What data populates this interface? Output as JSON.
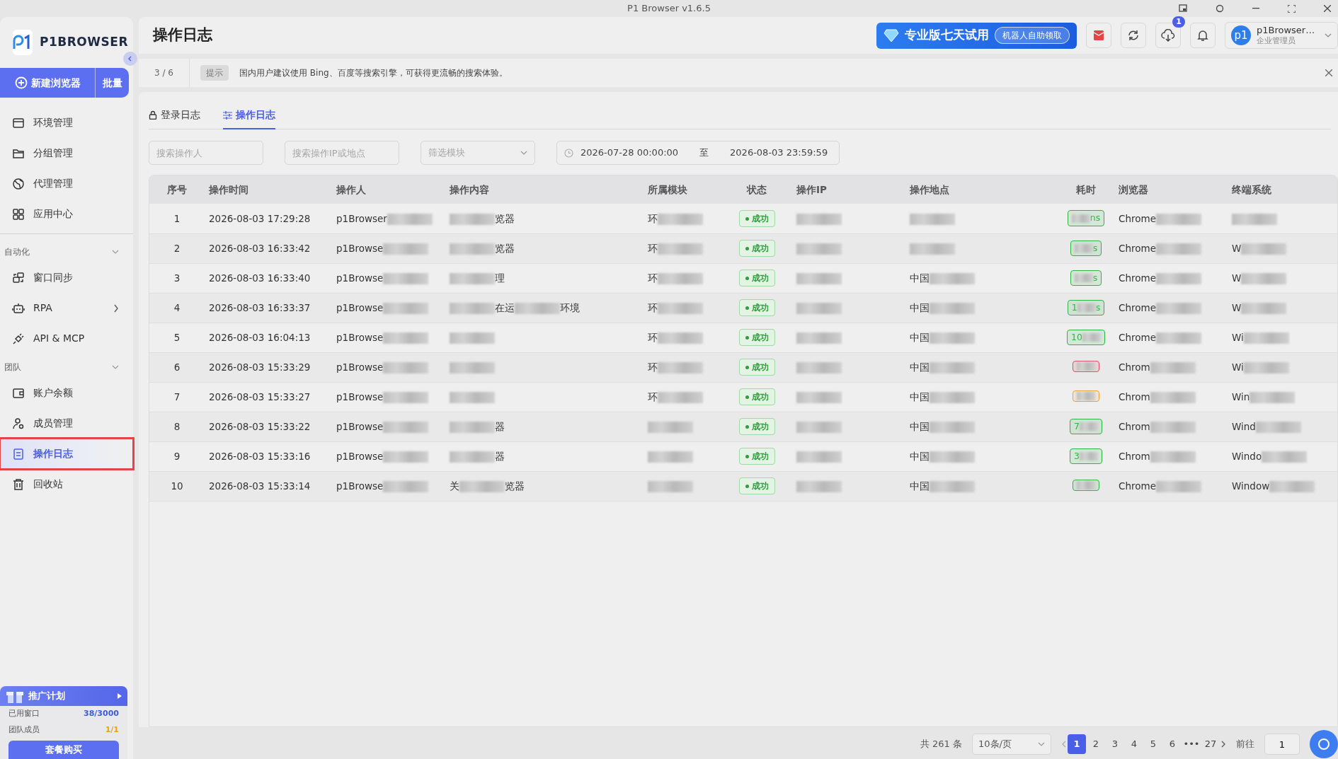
{
  "window": {
    "title": "P1 Browser v1.6.5"
  },
  "sidebar": {
    "logo": "P1BROWSER",
    "new_button": "新建浏览器",
    "batch_button": "批量",
    "groups": [
      {
        "items": [
          {
            "label": "环境管理",
            "selected": false
          },
          {
            "label": "分组管理",
            "selected": false
          },
          {
            "label": "代理管理",
            "selected": false
          },
          {
            "label": "应用中心",
            "selected": false
          }
        ]
      },
      {
        "title": "自动化",
        "expanded": true,
        "items": [
          {
            "label": "窗口同步",
            "selected": false
          },
          {
            "label": "RPA",
            "selected": false,
            "submenu": true
          },
          {
            "label": "API & MCP",
            "selected": false
          }
        ]
      },
      {
        "title": "团队",
        "expanded": true,
        "items": [
          {
            "label": "账户余额",
            "selected": false
          },
          {
            "label": "成员管理",
            "selected": false
          },
          {
            "label": "操作日志",
            "selected": true
          },
          {
            "label": "回收站",
            "selected": false
          }
        ]
      }
    ],
    "promo": {
      "title": "推广计划",
      "stats": [
        {
          "label": "已用窗口",
          "value": "38/3000",
          "color": "#3b5bdb"
        },
        {
          "label": "团队成员",
          "value": "1/1",
          "color": "#e8a317"
        }
      ],
      "button": "套餐购买"
    }
  },
  "header": {
    "title": "操作日志",
    "trial": "专业版七天试用",
    "trial_button": "机器人自助领取",
    "download_badge": "1",
    "user": {
      "avatar": "p1",
      "name": "p1Browser…",
      "role": "企业管理员"
    }
  },
  "notice": {
    "counter": "3 / 6",
    "tag": "提示",
    "text": "国内用户建议使用 Bing、百度等搜索引擎，可获得更流畅的搜索体验。"
  },
  "tabs": [
    {
      "label": "登录日志",
      "selected": false
    },
    {
      "label": "操作日志",
      "selected": true
    }
  ],
  "filters": {
    "operator": {
      "placeholder": "搜索操作人"
    },
    "ip": {
      "placeholder": "搜索操作IP或地点"
    },
    "module": {
      "placeholder": "筛选模块"
    },
    "date_from": "2026-07-28 00:00:00",
    "date_sep": "至",
    "date_to": "2026-08-03 23:59:59"
  },
  "table": {
    "columns": [
      "序号",
      "操作时间",
      "操作人",
      "操作内容",
      "所属模块",
      "状态",
      "操作IP",
      "操作地点",
      "耗时",
      "浏览器",
      "终端系统"
    ],
    "rows": [
      {
        "no": "1",
        "time": "2026-08-03 17:29:28",
        "operator": [
          {
            "text": "p1Browser"
          },
          {
            "redacted": true
          }
        ],
        "content": [
          {
            "redacted": true
          },
          {
            "text": "览器"
          }
        ],
        "module": [
          {
            "text": "环"
          },
          {
            "redacted": true
          }
        ],
        "status": "成功",
        "ip": [
          {
            "redacted": true
          }
        ],
        "location": [
          {
            "redacted": true
          }
        ],
        "duration": {
          "parts": [
            {
              "redacted": true
            },
            {
              "text": "ns"
            }
          ],
          "color": "#2fb344"
        },
        "browser": [
          {
            "text": "Chrome"
          },
          {
            "redacted": true
          }
        ],
        "os": [
          {
            "redacted": true
          }
        ]
      },
      {
        "no": "2",
        "time": "2026-08-03 16:33:42",
        "operator": [
          {
            "text": "p1Browse"
          },
          {
            "redacted": true
          }
        ],
        "content": [
          {
            "redacted": true
          },
          {
            "text": "览器"
          }
        ],
        "module": [
          {
            "text": "环"
          },
          {
            "redacted": true
          }
        ],
        "status": "成功",
        "ip": [
          {
            "redacted": true
          }
        ],
        "location": [
          {
            "redacted": true
          }
        ],
        "duration": {
          "parts": [
            {
              "redacted": true
            },
            {
              "text": "s"
            }
          ],
          "color": "#2fb344"
        },
        "browser": [
          {
            "text": "Chrome"
          },
          {
            "redacted": true
          }
        ],
        "os": [
          {
            "text": "W"
          },
          {
            "redacted": true
          }
        ]
      },
      {
        "no": "3",
        "time": "2026-08-03 16:33:40",
        "operator": [
          {
            "text": "p1Browse"
          },
          {
            "redacted": true
          }
        ],
        "content": [
          {
            "redacted": true
          },
          {
            "text": "理"
          }
        ],
        "module": [
          {
            "text": "环"
          },
          {
            "redacted": true
          }
        ],
        "status": "成功",
        "ip": [
          {
            "redacted": true
          }
        ],
        "location": [
          {
            "text": "中国"
          },
          {
            "redacted": true
          }
        ],
        "duration": {
          "parts": [
            {
              "redacted": true
            },
            {
              "text": "s"
            }
          ],
          "color": "#2fb344"
        },
        "browser": [
          {
            "text": "Chrome"
          },
          {
            "redacted": true
          }
        ],
        "os": [
          {
            "text": "W"
          },
          {
            "redacted": true
          }
        ]
      },
      {
        "no": "4",
        "time": "2026-08-03 16:33:37",
        "operator": [
          {
            "text": "p1Browse"
          },
          {
            "redacted": true
          }
        ],
        "content": [
          {
            "redacted": true
          },
          {
            "text": "在运"
          },
          {
            "redacted": true
          },
          {
            "text": "环境"
          }
        ],
        "module": [
          {
            "text": "环"
          },
          {
            "redacted": true
          }
        ],
        "status": "成功",
        "ip": [
          {
            "redacted": true
          }
        ],
        "location": [
          {
            "text": "中国"
          },
          {
            "redacted": true
          }
        ],
        "duration": {
          "parts": [
            {
              "text": "1"
            },
            {
              "redacted": true
            },
            {
              "text": "s"
            }
          ],
          "color": "#2fb344"
        },
        "browser": [
          {
            "text": "Chrome"
          },
          {
            "redacted": true
          }
        ],
        "os": [
          {
            "text": "W"
          },
          {
            "redacted": true
          }
        ]
      },
      {
        "no": "5",
        "time": "2026-08-03 16:04:13",
        "operator": [
          {
            "text": "p1Browse"
          },
          {
            "redacted": true
          }
        ],
        "content": [
          {
            "redacted": true
          }
        ],
        "module": [
          {
            "text": "环"
          },
          {
            "redacted": true
          }
        ],
        "status": "成功",
        "ip": [
          {
            "redacted": true
          }
        ],
        "location": [
          {
            "text": "中国"
          },
          {
            "redacted": true
          }
        ],
        "duration": {
          "parts": [
            {
              "text": "10"
            },
            {
              "redacted": true
            }
          ],
          "color": "#2fb344"
        },
        "browser": [
          {
            "text": "Chrome"
          },
          {
            "redacted": true
          }
        ],
        "os": [
          {
            "text": "Wi"
          },
          {
            "redacted": true
          }
        ]
      },
      {
        "no": "6",
        "time": "2026-08-03 15:33:29",
        "operator": [
          {
            "text": "p1Browse"
          },
          {
            "redacted": true
          }
        ],
        "content": [
          {
            "redacted": true
          }
        ],
        "module": [
          {
            "text": "环"
          },
          {
            "redacted": true
          }
        ],
        "status": "成功",
        "ip": [
          {
            "redacted": true
          }
        ],
        "location": [
          {
            "text": "中国"
          },
          {
            "redacted": true
          }
        ],
        "duration": {
          "parts": [
            {
              "redacted": true
            }
          ],
          "color": "#e5485f"
        },
        "browser": [
          {
            "text": "Chrom"
          },
          {
            "redacted": true
          }
        ],
        "os": [
          {
            "text": "Wi"
          },
          {
            "redacted": true
          }
        ]
      },
      {
        "no": "7",
        "time": "2026-08-03 15:33:27",
        "operator": [
          {
            "text": "p1Browse"
          },
          {
            "redacted": true
          }
        ],
        "content": [
          {
            "redacted": true
          }
        ],
        "module": [
          {
            "text": "环"
          },
          {
            "redacted": true
          }
        ],
        "status": "成功",
        "ip": [
          {
            "redacted": true
          }
        ],
        "location": [
          {
            "text": "中国"
          },
          {
            "redacted": true
          }
        ],
        "duration": {
          "parts": [
            {
              "redacted": true
            }
          ],
          "color": "#f0a030"
        },
        "browser": [
          {
            "text": "Chrom"
          },
          {
            "redacted": true
          }
        ],
        "os": [
          {
            "text": "Win"
          },
          {
            "redacted": true
          }
        ]
      },
      {
        "no": "8",
        "time": "2026-08-03 15:33:22",
        "operator": [
          {
            "text": "p1Browse"
          },
          {
            "redacted": true
          }
        ],
        "content": [
          {
            "redacted": true
          },
          {
            "text": "器"
          }
        ],
        "module": [
          {
            "redacted": true
          }
        ],
        "status": "成功",
        "ip": [
          {
            "redacted": true
          }
        ],
        "location": [
          {
            "text": "中国"
          },
          {
            "redacted": true
          }
        ],
        "duration": {
          "parts": [
            {
              "text": "7"
            },
            {
              "redacted": true
            }
          ],
          "color": "#2fb344"
        },
        "browser": [
          {
            "text": "Chrom"
          },
          {
            "redacted": true
          }
        ],
        "os": [
          {
            "text": "Wind"
          },
          {
            "redacted": true
          }
        ]
      },
      {
        "no": "9",
        "time": "2026-08-03 15:33:16",
        "operator": [
          {
            "text": "p1Browse"
          },
          {
            "redacted": true
          }
        ],
        "content": [
          {
            "redacted": true
          },
          {
            "text": "器"
          }
        ],
        "module": [
          {
            "redacted": true
          }
        ],
        "status": "成功",
        "ip": [
          {
            "redacted": true
          }
        ],
        "location": [
          {
            "text": "中国"
          },
          {
            "redacted": true
          }
        ],
        "duration": {
          "parts": [
            {
              "text": "3"
            },
            {
              "redacted": true
            }
          ],
          "color": "#2fb344"
        },
        "browser": [
          {
            "text": "Chrom"
          },
          {
            "redacted": true
          }
        ],
        "os": [
          {
            "text": "Windo"
          },
          {
            "redacted": true
          }
        ]
      },
      {
        "no": "10",
        "time": "2026-08-03 15:33:14",
        "operator": [
          {
            "text": "p1Browse"
          },
          {
            "redacted": true
          }
        ],
        "content": [
          {
            "text": "关"
          },
          {
            "redacted": true
          },
          {
            "text": "览器"
          }
        ],
        "module": [
          {
            "redacted": true
          }
        ],
        "status": "成功",
        "ip": [
          {
            "redacted": true
          }
        ],
        "location": [
          {
            "text": "中国"
          },
          {
            "redacted": true
          }
        ],
        "duration": {
          "parts": [
            {
              "redacted": true
            }
          ],
          "color": "#2fb344"
        },
        "browser": [
          {
            "text": "Chrome"
          },
          {
            "redacted": true
          }
        ],
        "os": [
          {
            "text": "Window"
          },
          {
            "redacted": true
          }
        ]
      }
    ]
  },
  "pagination": {
    "total": "共 261 条",
    "page_size": "10条/页",
    "pages": [
      {
        "label": "1",
        "selected": true
      },
      {
        "label": "2",
        "selected": false
      },
      {
        "label": "3",
        "selected": false
      },
      {
        "label": "4",
        "selected": false
      },
      {
        "label": "5",
        "selected": false
      },
      {
        "label": "6",
        "selected": false
      },
      {
        "label": "•••",
        "selected": false
      },
      {
        "label": "27",
        "selected": false
      }
    ],
    "goto_label": "前往",
    "goto_value": "1"
  }
}
